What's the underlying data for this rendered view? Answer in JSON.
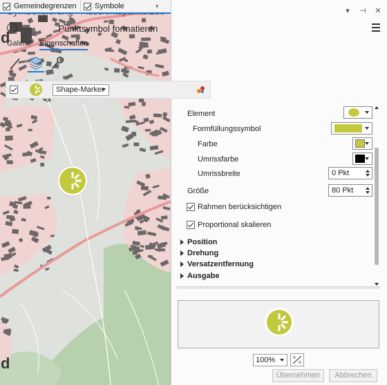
{
  "map": {
    "tabs": [
      {
        "label": "Gemeindegrenzen"
      },
      {
        "label": "Symbole"
      }
    ],
    "corner_letter": "d"
  },
  "panel": {
    "title": "Symbolisierung - Aussichtspunkt 180°",
    "subtitle": "Punktsymbol formatieren",
    "nav_tabs": [
      {
        "label": "Galerie"
      },
      {
        "label": "Eigenschaften"
      }
    ],
    "layer": {
      "type_value": "Shape-Marker"
    },
    "properties": {
      "element_label": "Element",
      "fill_symbol_label": "Formfüllungssymbol",
      "color_label": "Farbe",
      "outline_color_label": "Umrissfarbe",
      "outline_width_label": "Umrissbreite",
      "outline_width_value": "0 Pkt",
      "size_label": "Größe",
      "size_value": "80 Pkt",
      "respect_frame_label": "Rahmen berücksichtigen",
      "scale_proportional_label": "Proportional skalieren"
    },
    "sections": [
      {
        "label": "Position"
      },
      {
        "label": "Drehung"
      },
      {
        "label": "Versatzentfernung"
      },
      {
        "label": "Ausgabe"
      }
    ],
    "zoom_value": "100%",
    "buttons": {
      "apply": "Übernehmen",
      "cancel": "Abbrechen"
    }
  },
  "colors": {
    "marker_fill": "#c3c93f",
    "outline": "#000000",
    "accent": "#1e7ad6",
    "road": "#e89a98",
    "residential": "#f0d4d2",
    "building": "#6d6768"
  }
}
